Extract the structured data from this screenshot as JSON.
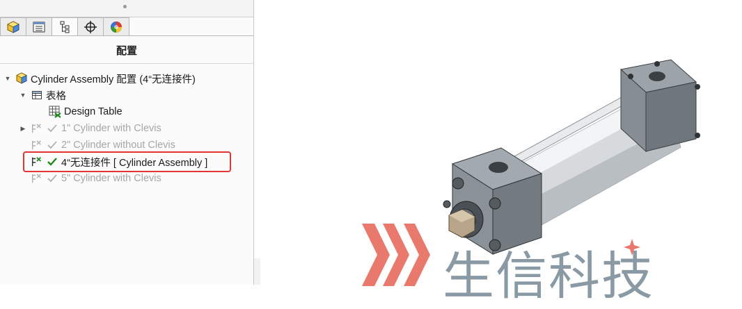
{
  "panel": {
    "title": "配置",
    "tabs": [
      {
        "name": "feature-manager"
      },
      {
        "name": "property-manager"
      },
      {
        "name": "configuration-manager"
      },
      {
        "name": "dimxpert-manager"
      },
      {
        "name": "display-manager"
      }
    ],
    "active_tab": 2
  },
  "tree": {
    "root_label": "Cylinder Assembly 配置  (4“无连接件)",
    "tables_label": "表格",
    "design_table_label": "Design Table",
    "configs": [
      {
        "label": "1\" Cylinder with Clevis",
        "active": false
      },
      {
        "label": "2\" Cylinder without Clevis",
        "active": false
      },
      {
        "label": "4“无连接件 [ Cylinder Assembly ]",
        "active": true
      },
      {
        "label": "5\" Cylinder with Clevis",
        "active": false
      }
    ]
  },
  "watermark": {
    "text": "生信科技",
    "colors": {
      "stripes": "#e9786d",
      "text": "#8a9aa5",
      "star": "#e9786d"
    }
  }
}
